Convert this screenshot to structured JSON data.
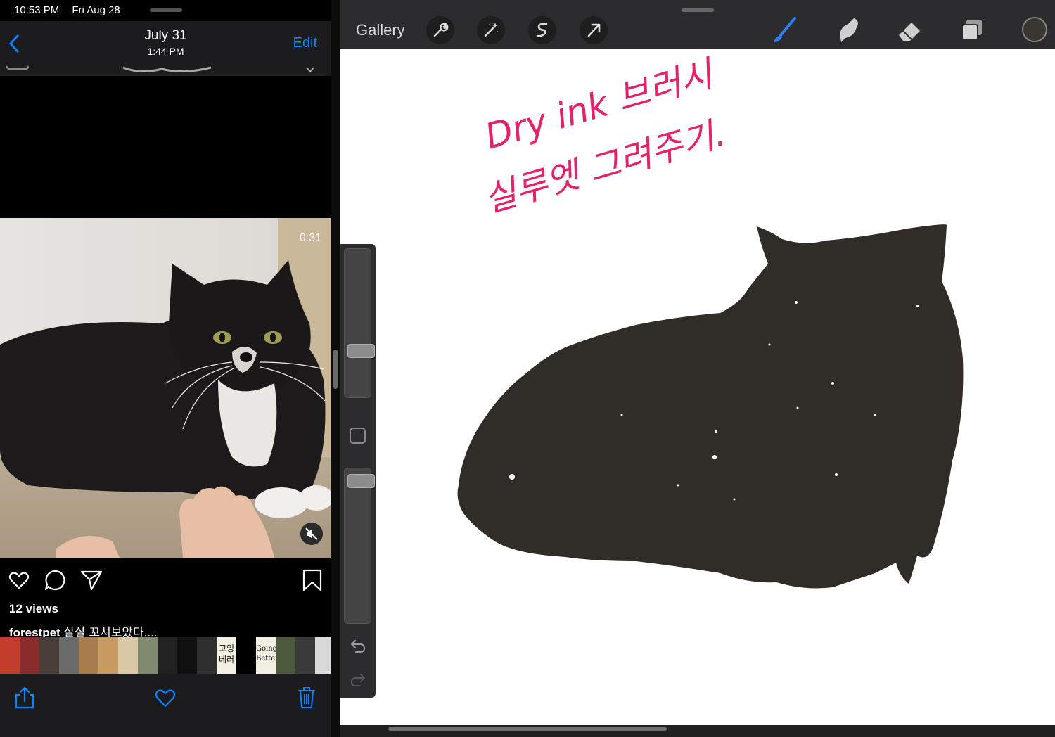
{
  "status_bar": {
    "time": "10:53 PM",
    "date": "Fri Aug 28"
  },
  "photos": {
    "nav": {
      "title": "July 31",
      "subtitle": "1:44 PM",
      "edit_label": "Edit"
    },
    "video": {
      "duration": "0:31"
    },
    "post": {
      "views": "12 views",
      "caption_user": "forestpet",
      "caption_text": "살살 꼬셔보았다...."
    },
    "thumbnails": {
      "text_items": [
        "고잉",
        "베러",
        "Going",
        "Better"
      ]
    },
    "toolbar": {
      "share": "share-icon",
      "favorite": "heart-icon",
      "delete": "trash-icon"
    }
  },
  "procreate": {
    "gallery_label": "Gallery",
    "tools_left": [
      "wrench-icon",
      "magic-wand-icon",
      "selection-icon",
      "transform-arrow-icon"
    ],
    "tools_right": [
      "brush-icon",
      "smudge-icon",
      "eraser-icon",
      "layers-icon",
      "color-icon"
    ],
    "active_tool": "brush-icon",
    "accent_color": "#2f7ef5",
    "ink_color": "#e2236b",
    "silhouette_color": "#302d29",
    "handwriting": {
      "line1": "Dry ink 브러시",
      "line2": "실루엣 그려주기."
    }
  }
}
